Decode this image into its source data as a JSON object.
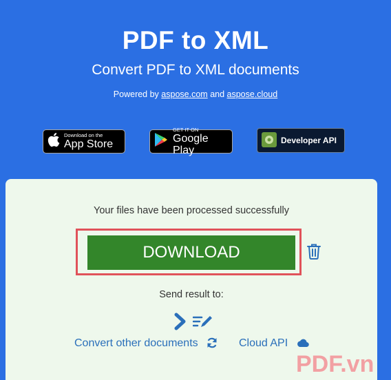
{
  "header": {
    "title": "PDF to XML",
    "subtitle": "Convert PDF to XML documents",
    "powered_prefix": "Powered by",
    "powered_link1": "aspose.com",
    "powered_and": "and",
    "powered_link2": "aspose.cloud"
  },
  "stores": {
    "appstore_small": "Download on the",
    "appstore_big": "App Store",
    "googleplay_small": "GET IT ON",
    "googleplay_big": "Google Play",
    "developer_api": "Developer API"
  },
  "result": {
    "status": "Your files have been processed successfully",
    "download_label": "DOWNLOAD",
    "send_result": "Send result to:",
    "convert_other": "Convert other documents",
    "cloud_api": "Cloud API"
  },
  "watermark": "PDF.vn",
  "colors": {
    "background": "#2b6fe3",
    "card": "#eef8ec",
    "download": "#33862a",
    "highlight": "#e0525a",
    "link": "#2a6fba"
  }
}
